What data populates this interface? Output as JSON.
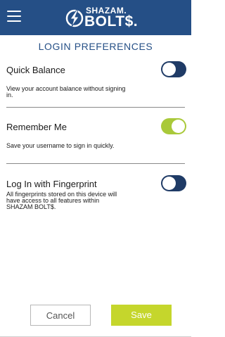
{
  "header": {
    "menu_icon": "hamburger-menu-icon",
    "logo_icon": "lightning-bolt-icon",
    "logo_line1": "SHAZAM.",
    "logo_line2": "BOLT$.",
    "background_color": "#254f86"
  },
  "page": {
    "title": "LOGIN PREFERENCES"
  },
  "settings": [
    {
      "label": "Quick Balance",
      "description": "View your account balance without signing in.",
      "enabled": false
    },
    {
      "label": "Remember Me",
      "description": "Save your username to sign in quickly.",
      "enabled": true
    },
    {
      "label": "Log In with Fingerprint",
      "description": "All fingerprints stored on this device will have access to all features within SHAZAM BOLT$.",
      "enabled": false
    }
  ],
  "colors": {
    "toggle_off": "#1f3b66",
    "toggle_on": "#a9c93a",
    "accent": "#c5d62c",
    "title": "#254f86"
  },
  "actions": {
    "cancel_label": "Cancel",
    "save_label": "Save"
  }
}
